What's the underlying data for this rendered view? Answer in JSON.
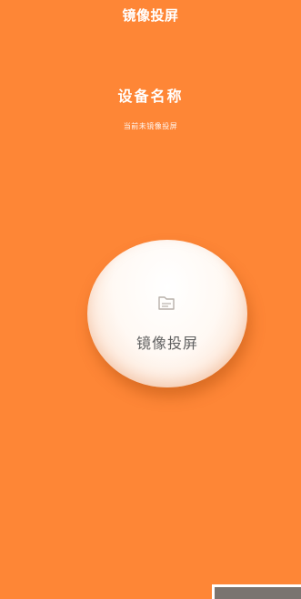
{
  "header": {
    "title": "镜像投屏"
  },
  "device": {
    "name": "设备名称",
    "status": "当前未镜像投屏"
  },
  "cast_button": {
    "label": "镜像投屏",
    "icon": "screen-cast-icon"
  },
  "colors": {
    "background": "#fe8636",
    "button": "#fff9f4",
    "button_text": "#606060"
  }
}
